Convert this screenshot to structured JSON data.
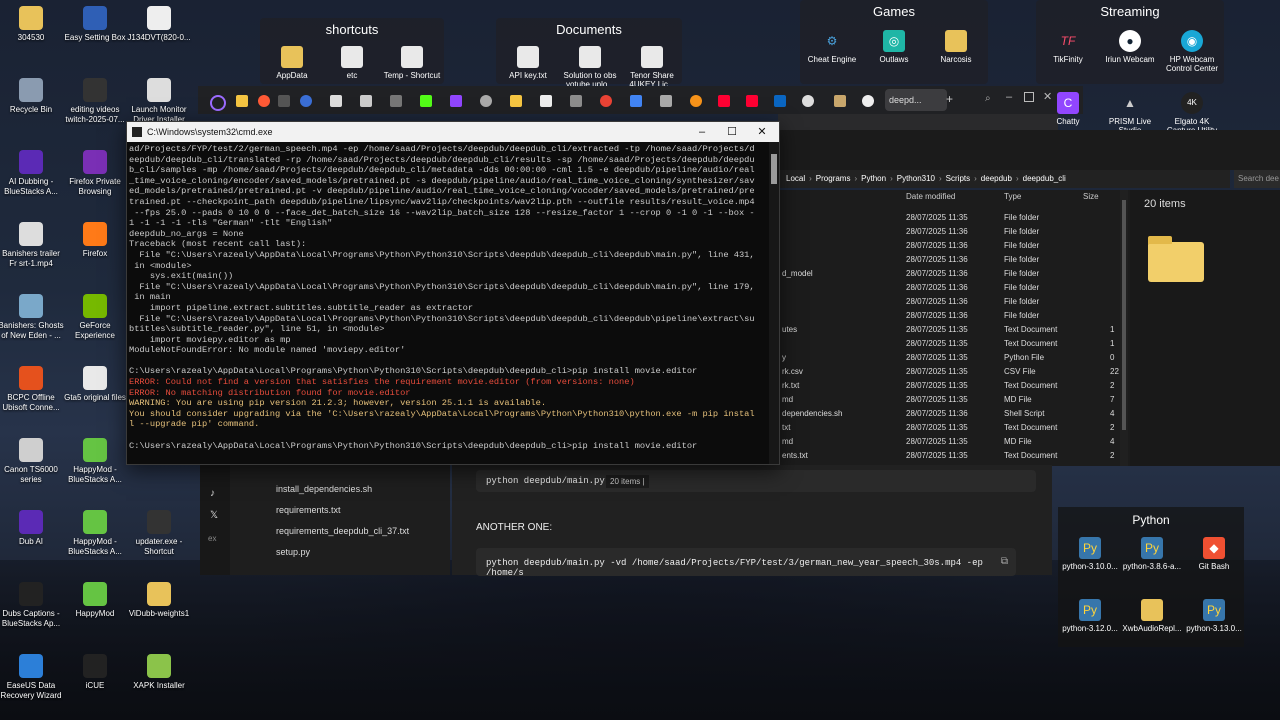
{
  "desktop": {
    "icons_left": [
      {
        "label": "304530",
        "icon": "folder-icon",
        "color": "#e8c25a"
      },
      {
        "label": "Recycle Bin",
        "icon": "recycle-bin-icon",
        "color": "#8a9bb0"
      },
      {
        "label": "AI Dubbing - BlueStacks A...",
        "icon": "bluestacks-icon",
        "color": "#5b2ab5"
      },
      {
        "label": "Banishers trailer Fr srt-1.mp4",
        "icon": "video-file-icon",
        "color": "#ddd"
      },
      {
        "label": "Banishers: Ghosts of New Eden - ...",
        "icon": "game-icon",
        "color": "#7aa8c9"
      },
      {
        "label": "BCPC Offline Ubisoft Conne...",
        "icon": "bcpc-icon",
        "color": "#e5511d"
      },
      {
        "label": "Canon TS6000 series",
        "icon": "printer-icon",
        "color": "#cfcfcf"
      },
      {
        "label": "Dub AI",
        "icon": "dubai-icon",
        "color": "#5b2ab5"
      },
      {
        "label": "Dubs Captions - BlueStacks Ap...",
        "icon": "captions-icon",
        "color": "#222"
      },
      {
        "label": "EaseUS Data Recovery Wizard",
        "icon": "easeus-icon",
        "color": "#2c7fd8"
      }
    ],
    "icons_col2": [
      {
        "label": "Easy Setting Box",
        "icon": "settings-box-icon",
        "color": "#2f5fb5"
      },
      {
        "label": "editing videos twitch-2025-07...",
        "icon": "video-file-icon",
        "color": "#333"
      },
      {
        "label": "Firefox Private Browsing",
        "icon": "firefox-private-icon",
        "color": "#7a2fb5"
      },
      {
        "label": "Firefox",
        "icon": "firefox-icon",
        "color": "#ff7a18"
      },
      {
        "label": "GeForce Experience",
        "icon": "nvidia-icon",
        "color": "#76b900"
      },
      {
        "label": "Gta5 original files",
        "icon": "file-icon",
        "color": "#e9e9e9"
      },
      {
        "label": "HappyMod - BlueStacks A...",
        "icon": "happymod-icon",
        "color": "#65c443"
      },
      {
        "label": "HappyMod - BlueStacks A...",
        "icon": "happymod-icon",
        "color": "#65c443"
      },
      {
        "label": "HappyMod",
        "icon": "happymod-icon",
        "color": "#65c443"
      },
      {
        "label": "iCUE",
        "icon": "icue-icon",
        "color": "#222"
      }
    ],
    "icons_col3": [
      {
        "label": "J134DVT(820-0...",
        "icon": "document-icon",
        "color": "#eee"
      },
      {
        "label": "Launch Monitor Driver Installer",
        "icon": "installer-icon",
        "color": "#ddd"
      },
      {
        "label": "updater.exe - Shortcut",
        "icon": "updater-icon",
        "color": "#333"
      },
      {
        "label": "ViDubb-weights1",
        "icon": "zip-icon",
        "color": "#e8c25a"
      },
      {
        "label": "XAPK Installer",
        "icon": "android-icon",
        "color": "#8bc34a"
      }
    ]
  },
  "fences": {
    "shortcuts": {
      "title": "shortcuts",
      "items": [
        "AppData",
        "etc",
        "Temp - Shortcut"
      ]
    },
    "documents": {
      "title": "Documents",
      "items": [
        "API key.txt",
        "Solution to obs yotube uplo...",
        "Tenor Share 4UKEY Lic..."
      ]
    },
    "games": {
      "title": "Games",
      "items": [
        "Cheat Engine",
        "Outlaws",
        "Narcosis"
      ]
    },
    "streaming": {
      "title": "Streaming",
      "items": [
        "TikFinity",
        "Iriun Webcam",
        "HP Webcam Control Center"
      ]
    },
    "streaming_row2": [
      "Chatty",
      "PRISM Live Studio",
      "Elgato 4K Capture Utility"
    ]
  },
  "browser": {
    "active_tab": "deepd..."
  },
  "cmd": {
    "title": "C:\\Windows\\system32\\cmd.exe",
    "lines": [
      {
        "t": "ad/Projects/FYP/test/2/german_speech.mp4 -ep /home/saad/Projects/deepdub/deepdub_cli/extracted -tp /home/saad/Projects/d",
        "c": ""
      },
      {
        "t": "eepdub/deepdub_cli/translated -rp /home/saad/Projects/deepdub/deepdub_cli/results -sp /home/saad/Projects/deepdub/deepdu",
        "c": ""
      },
      {
        "t": "b_cli/samples -mp /home/saad/Projects/deepdub/deepdub_cli/metadata -dds 00:00:00 -cml 1.5 -e deepdub/pipeline/audio/real",
        "c": ""
      },
      {
        "t": "_time_voice_cloning/encoder/saved_models/pretrained.pt -s deepdub/pipeline/audio/real_time_voice_cloning/synthesizer/sav",
        "c": ""
      },
      {
        "t": "ed_models/pretrained/pretrained.pt -v deepdub/pipeline/audio/real_time_voice_cloning/vocoder/saved_models/pretrained/pre",
        "c": ""
      },
      {
        "t": "trained.pt --checkpoint_path deepdub/pipeline/lipsync/wav2lip/checkpoints/wav2lip.pth --outfile results/result_voice.mp4",
        "c": ""
      },
      {
        "t": " --fps 25.0 --pads 0 10 0 0 --face_det_batch_size 16 --wav2lip_batch_size 128 --resize_factor 1 --crop 0 -1 0 -1 --box -",
        "c": ""
      },
      {
        "t": "1 -1 -1 -1 -tls \"German\" -tlt \"English\"",
        "c": ""
      },
      {
        "t": "deepdub_no_args = None",
        "c": ""
      },
      {
        "t": "Traceback (most recent call last):",
        "c": ""
      },
      {
        "t": "  File \"C:\\Users\\razealy\\AppData\\Local\\Programs\\Python\\Python310\\Scripts\\deepdub\\deepdub_cli\\deepdub\\main.py\", line 431,",
        "c": ""
      },
      {
        "t": " in <module>",
        "c": ""
      },
      {
        "t": "    sys.exit(main())",
        "c": ""
      },
      {
        "t": "  File \"C:\\Users\\razealy\\AppData\\Local\\Programs\\Python\\Python310\\Scripts\\deepdub\\deepdub_cli\\deepdub\\main.py\", line 179,",
        "c": ""
      },
      {
        "t": " in main",
        "c": ""
      },
      {
        "t": "    import pipeline.extract.subtitles.subtitle_reader as extractor",
        "c": ""
      },
      {
        "t": "  File \"C:\\Users\\razealy\\AppData\\Local\\Programs\\Python\\Python310\\Scripts\\deepdub\\deepdub_cli\\deepdub\\pipeline\\extract\\su",
        "c": ""
      },
      {
        "t": "btitles\\subtitle_reader.py\", line 51, in <module>",
        "c": ""
      },
      {
        "t": "    import moviepy.editor as mp",
        "c": ""
      },
      {
        "t": "ModuleNotFoundError: No module named 'moviepy.editor'",
        "c": ""
      },
      {
        "t": " ",
        "c": ""
      },
      {
        "t": "C:\\Users\\razealy\\AppData\\Local\\Programs\\Python\\Python310\\Scripts\\deepdub\\deepdub_cli>pip install movie.editor",
        "c": ""
      },
      {
        "t": "ERROR: Could not find a version that satisfies the requirement movie.editor (from versions: none)",
        "c": "err"
      },
      {
        "t": "ERROR: No matching distribution found for movie.editor",
        "c": "err"
      },
      {
        "t": "WARNING: You are using pip version 21.2.3; however, version 25.1.1 is available.",
        "c": "warn"
      },
      {
        "t": "You should consider upgrading via the 'C:\\Users\\razealy\\AppData\\Local\\Programs\\Python\\Python310\\python.exe -m pip instal",
        "c": "warn"
      },
      {
        "t": "l --upgrade pip' command.",
        "c": "warn"
      },
      {
        "t": " ",
        "c": ""
      },
      {
        "t": "C:\\Users\\razealy\\AppData\\Local\\Programs\\Python\\Python310\\Scripts\\deepdub\\deepdub_cli>pip install movie.editor",
        "c": ""
      }
    ]
  },
  "explorer": {
    "breadcrumb": [
      "Local",
      "Programs",
      "Python",
      "Python310",
      "Scripts",
      "deepdub",
      "deepdub_cli"
    ],
    "search_placeholder": "Search dee",
    "columns": {
      "date": "Date modified",
      "type": "Type",
      "size": "Size"
    },
    "item_count": "20 items",
    "status_count": "20 items",
    "rows": [
      {
        "name": "",
        "date": "28/07/2025 11:35",
        "type": "File folder",
        "size": ""
      },
      {
        "name": "",
        "date": "28/07/2025 11:36",
        "type": "File folder",
        "size": ""
      },
      {
        "name": "",
        "date": "28/07/2025 11:36",
        "type": "File folder",
        "size": ""
      },
      {
        "name": "",
        "date": "28/07/2025 11:36",
        "type": "File folder",
        "size": ""
      },
      {
        "name": "d_model",
        "date": "28/07/2025 11:36",
        "type": "File folder",
        "size": ""
      },
      {
        "name": "",
        "date": "28/07/2025 11:36",
        "type": "File folder",
        "size": ""
      },
      {
        "name": "",
        "date": "28/07/2025 11:36",
        "type": "File folder",
        "size": ""
      },
      {
        "name": "",
        "date": "28/07/2025 11:36",
        "type": "File folder",
        "size": ""
      },
      {
        "name": "utes",
        "date": "28/07/2025 11:35",
        "type": "Text Document",
        "size": "1"
      },
      {
        "name": "",
        "date": "28/07/2025 11:35",
        "type": "Text Document",
        "size": "1"
      },
      {
        "name": "y",
        "date": "28/07/2025 11:35",
        "type": "Python File",
        "size": "0"
      },
      {
        "name": "rk.csv",
        "date": "28/07/2025 11:35",
        "type": "CSV File",
        "size": "22"
      },
      {
        "name": "rk.txt",
        "date": "28/07/2025 11:35",
        "type": "Text Document",
        "size": "2"
      },
      {
        "name": "md",
        "date": "28/07/2025 11:35",
        "type": "MD File",
        "size": "7"
      },
      {
        "name": "dependencies.sh",
        "date": "28/07/2025 11:36",
        "type": "Shell Script",
        "size": "4"
      },
      {
        "name": "txt",
        "date": "28/07/2025 11:35",
        "type": "Text Document",
        "size": "2"
      },
      {
        "name": "md",
        "date": "28/07/2025 11:35",
        "type": "MD File",
        "size": "4"
      },
      {
        "name": "ents.txt",
        "date": "28/07/2025 11:35",
        "type": "Text Document",
        "size": "2"
      }
    ]
  },
  "editor": {
    "files": [
      "install_dependencies.sh",
      "requirements.txt",
      "requirements_deepdub_cli_37.txt",
      "setup.py"
    ]
  },
  "chat": {
    "code1": "python deepdub/main.py",
    "heading": "ANOTHER ONE:",
    "code2": "python deepdub/main.py -vd /home/saad/Projects/FYP/test/3/german_new_year_speech_30s.mp4 -ep /home/s"
  },
  "python_group": {
    "title": "Python",
    "items": [
      "python-3.10.0...",
      "python-3.8.6-a...",
      "Git Bash",
      "python-3.12.0...",
      "XwbAudioRepl...",
      "python-3.13.0..."
    ]
  }
}
